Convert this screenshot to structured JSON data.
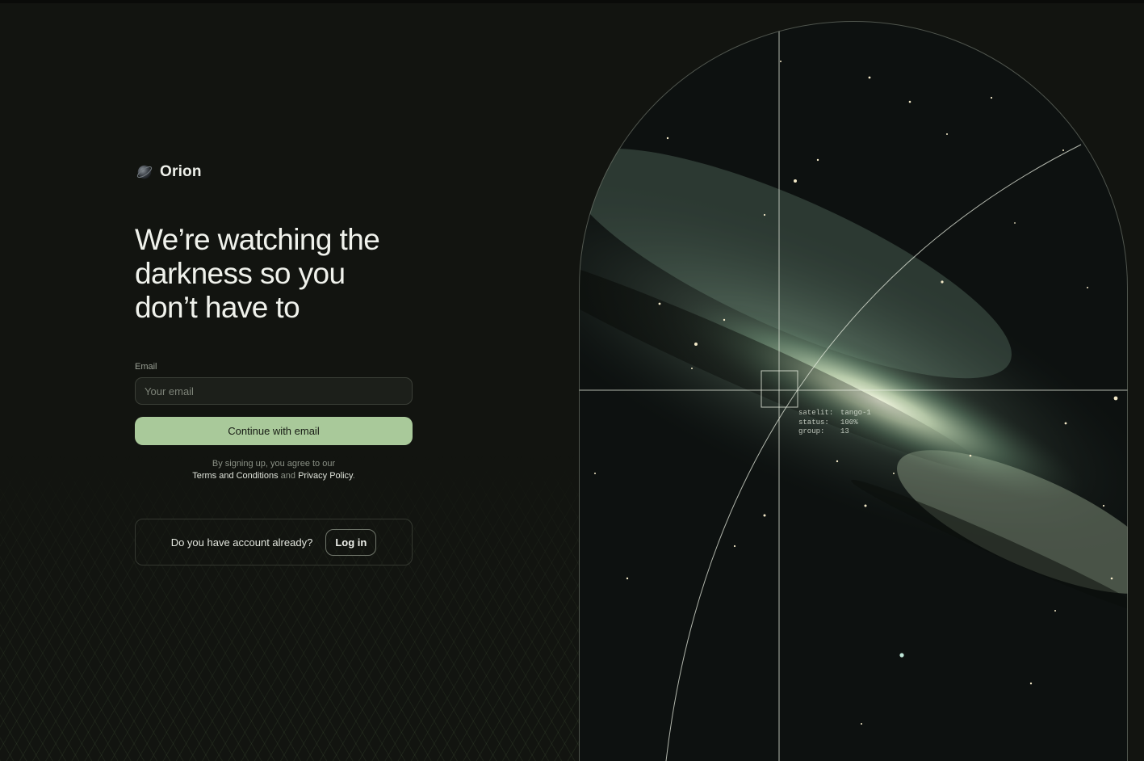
{
  "brand": {
    "name": "Orion",
    "icon": "planet-icon"
  },
  "headline": {
    "line1": "We’re watching the",
    "line2": "darkness so you",
    "line3": "don’t have to"
  },
  "form": {
    "email_label": "Email",
    "email_placeholder": "Your email",
    "email_value": "",
    "continue_label": "Continue with email"
  },
  "terms": {
    "prefix": "By signing up, you agree to our",
    "terms_link": "Terms and Conditions",
    "and": "and",
    "privacy_link": "Privacy Policy",
    "suffix": "."
  },
  "account": {
    "question": "Do you have account already?",
    "login_label": "Log in"
  },
  "hud": {
    "rows": [
      {
        "key": "satelit",
        "sep": ":",
        "value": "tango-1"
      },
      {
        "key": "status",
        "sep": ":",
        "value": "100%"
      },
      {
        "key": "group",
        "sep": ":",
        "value": "13"
      }
    ]
  },
  "colors": {
    "background": "#121410",
    "accent_button": "#a9c99a",
    "input_bg": "#1c1f1a",
    "text_primary": "#f0f2ec",
    "text_muted": "#8a9085"
  }
}
